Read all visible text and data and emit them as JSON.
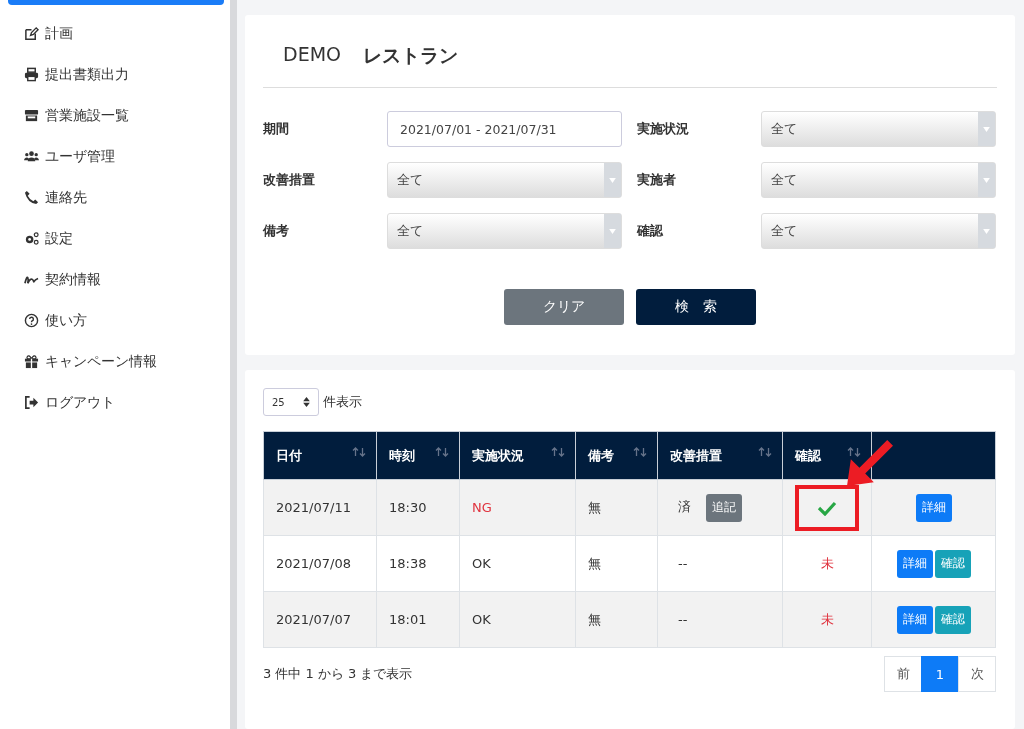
{
  "sidebar": {
    "top_item_selected": true,
    "items": [
      {
        "kind": "edit",
        "label": "計画",
        "selected": false
      },
      {
        "kind": "print",
        "label": "提出書類出力",
        "selected": false
      },
      {
        "kind": "store",
        "label": "営業施設一覧",
        "selected": false
      },
      {
        "kind": "users",
        "label": "ユーザ管理",
        "selected": false
      },
      {
        "kind": "phone",
        "label": "連絡先",
        "selected": false
      },
      {
        "kind": "gears",
        "label": "設定",
        "selected": false
      },
      {
        "kind": "signature",
        "label": "契約情報",
        "selected": false
      },
      {
        "kind": "question",
        "label": "使い方",
        "selected": false
      },
      {
        "kind": "gift",
        "label": "キャンペーン情報",
        "selected": false
      },
      {
        "kind": "logout",
        "label": "ログアウト",
        "selected": false
      }
    ]
  },
  "header": {
    "prefix": "DEMO",
    "title": "レストラン"
  },
  "filters": [
    {
      "label": "期間",
      "kind": "text",
      "value": "2021/07/01 - 2021/07/31"
    },
    {
      "label": "実施状況",
      "kind": "select",
      "value": "全て"
    },
    {
      "label": "改善措置",
      "kind": "select",
      "value": "全て"
    },
    {
      "label": "実施者",
      "kind": "select",
      "value": "全て"
    },
    {
      "label": "備考",
      "kind": "select",
      "value": "全て"
    },
    {
      "label": "確認",
      "kind": "select",
      "value": "全て"
    }
  ],
  "buttons": [
    {
      "label": "クリア",
      "kind": "secondary"
    },
    {
      "label": "検　索",
      "kind": "primary"
    }
  ],
  "page_size": {
    "value": "25",
    "label": "件表示"
  },
  "table": {
    "columns": [
      "日付",
      "時刻",
      "実施状況",
      "備考",
      "改善措置",
      "確認"
    ],
    "rows": [
      {
        "date": "2021/07/11",
        "time": "18:30",
        "status": {
          "text": "NG",
          "alert": true
        },
        "note": "無",
        "improvement": {
          "text": "済",
          "button": "追記"
        },
        "confirm": {
          "kind": "check",
          "highlighted": true
        },
        "actions": [
          {
            "label": "詳細",
            "kind": "detail"
          }
        ]
      },
      {
        "date": "2021/07/08",
        "time": "18:38",
        "status": {
          "text": "OK",
          "alert": false
        },
        "note": "無",
        "improvement": {
          "text": "--"
        },
        "confirm": {
          "kind": "text",
          "text": "未",
          "highlighted": false
        },
        "actions": [
          {
            "label": "詳細",
            "kind": "detail"
          },
          {
            "label": "確認",
            "kind": "confirm"
          }
        ]
      },
      {
        "date": "2021/07/07",
        "time": "18:01",
        "status": {
          "text": "OK",
          "alert": false
        },
        "note": "無",
        "improvement": {
          "text": "--"
        },
        "confirm": {
          "kind": "text",
          "text": "未",
          "highlighted": false
        },
        "actions": [
          {
            "label": "詳細",
            "kind": "detail"
          },
          {
            "label": "確認",
            "kind": "confirm"
          }
        ]
      }
    ]
  },
  "summary": "3 件中 1 から 3 まで表示",
  "pagination": [
    {
      "label": "前",
      "selected": false
    },
    {
      "label": "1",
      "selected": true
    },
    {
      "label": "次",
      "selected": false
    }
  ]
}
